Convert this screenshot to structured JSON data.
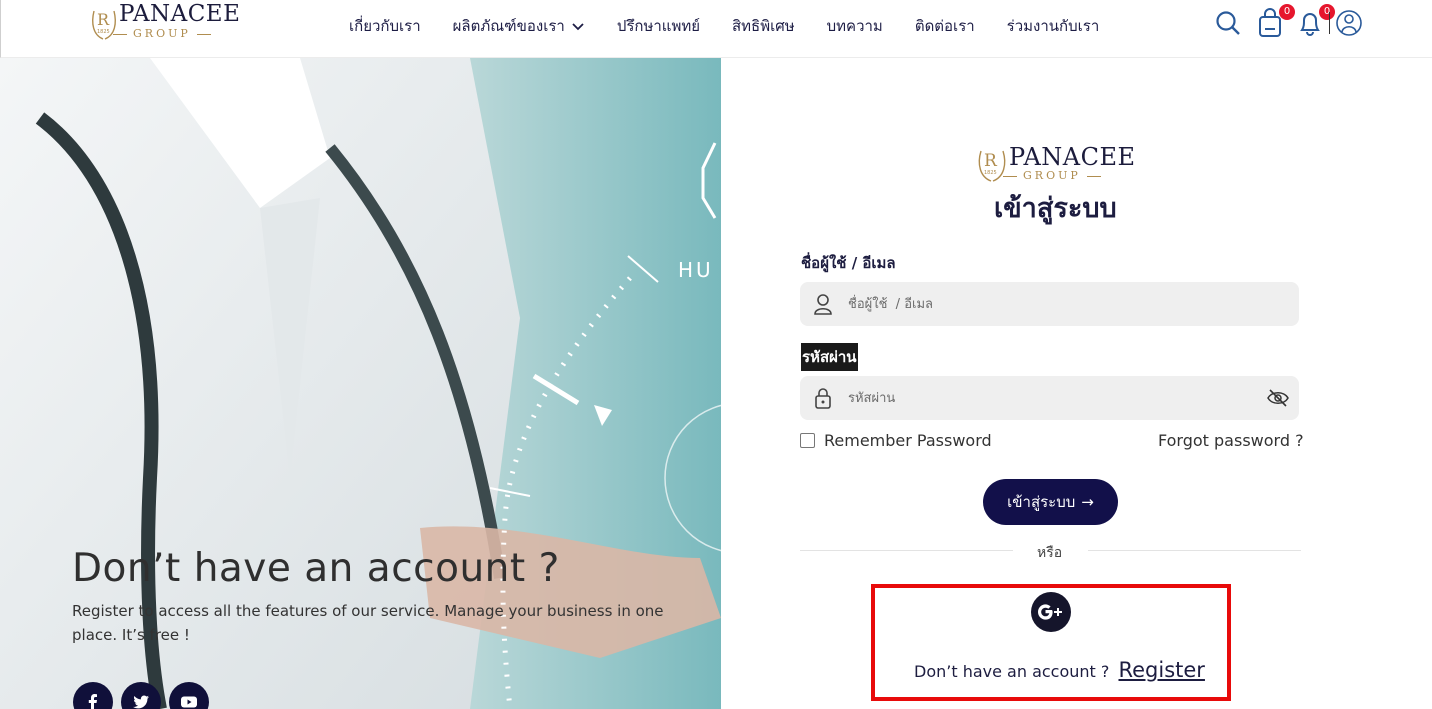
{
  "header": {
    "logo": {
      "brand": "PANACEE",
      "sub": "GROUP"
    },
    "nav": [
      {
        "label": "เกี่ยวกับเรา"
      },
      {
        "label": "ผลิตภัณฑ์ของเรา",
        "dropdown": true
      },
      {
        "label": "ปรึกษาแพทย์"
      },
      {
        "label": "สิทธิพิเศษ"
      },
      {
        "label": "บทความ"
      },
      {
        "label": "ติดต่อเรา"
      },
      {
        "label": "ร่วมงานกับเรา"
      }
    ],
    "icons": [
      "search-icon",
      "cart-icon",
      "bell-icon",
      "user-icon"
    ],
    "cart_count": "0",
    "notification_count": "0"
  },
  "hero": {
    "title": "Don’t have an account ?",
    "text": "Register to access all the features of our service. Manage your business in one place. It’s free !",
    "overlay_text": "HU",
    "social": [
      "facebook-icon",
      "twitter-icon",
      "youtube-icon"
    ]
  },
  "login": {
    "logo": {
      "brand": "PANACEE",
      "sub": "GROUP"
    },
    "title": "เข้าสู่ระบบ",
    "username_label": "ชื่อผู้ใช้ / อีเมล",
    "username_placeholder": "ชื่อผู้ใช้  / อีเมล",
    "password_label": "รหัสผ่าน",
    "password_placeholder": "รหัสผ่าน",
    "remember_label": "Remember Password",
    "forgot_label": "Forgot password ?",
    "submit_label": "เข้าสู่ระบบ",
    "submit_arrow": "→",
    "or_label": "หรือ",
    "register_prompt": "Don’t have an account ?",
    "register_link": "Register"
  },
  "colors": {
    "navy": "#12104a",
    "gold": "#b08d4f",
    "badge": "#e6162d",
    "highlight": "#e80a0a"
  }
}
